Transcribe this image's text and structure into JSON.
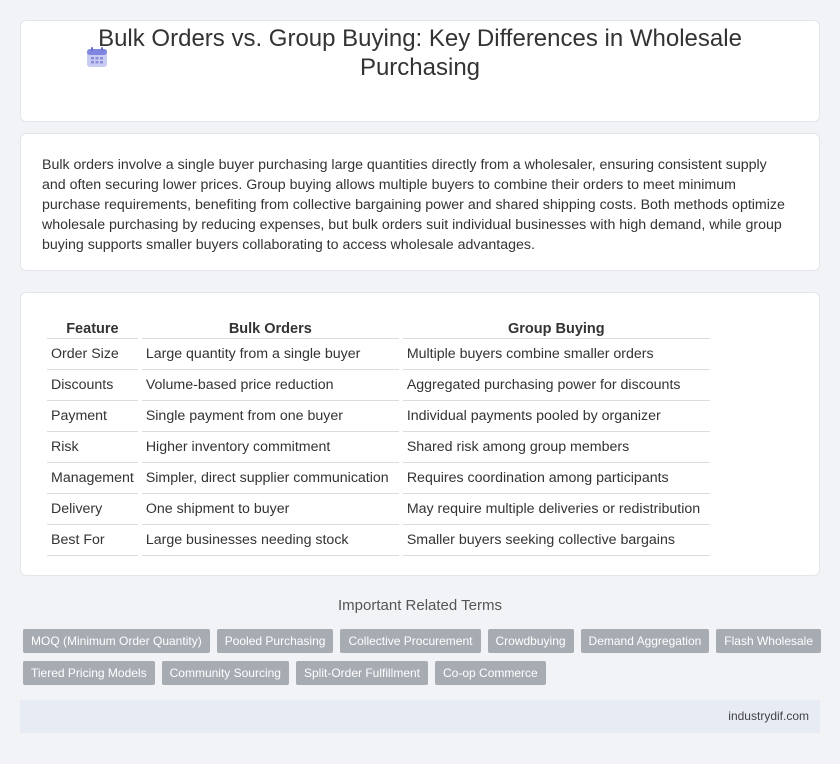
{
  "header": {
    "title": "Bulk Orders vs. Group Buying: Key Differences in Wholesale Purchasing",
    "icon": "calendar-icon"
  },
  "intro": {
    "text": "Bulk orders involve a single buyer purchasing large quantities directly from a wholesaler, ensuring consistent supply and often securing lower prices. Group buying allows multiple buyers to combine their orders to meet minimum purchase requirements, benefiting from collective bargaining power and shared shipping costs. Both methods optimize wholesale purchasing by reducing expenses, but bulk orders suit individual businesses with high demand, while group buying supports smaller buyers collaborating to access wholesale advantages."
  },
  "table": {
    "headers": [
      "Feature",
      "Bulk Orders",
      "Group Buying"
    ],
    "rows": [
      [
        "Order Size",
        "Large quantity from a single buyer",
        "Multiple buyers combine smaller orders"
      ],
      [
        "Discounts",
        "Volume-based price reduction",
        "Aggregated purchasing power for discounts"
      ],
      [
        "Payment",
        "Single payment from one buyer",
        "Individual payments pooled by organizer"
      ],
      [
        "Risk",
        "Higher inventory commitment",
        "Shared risk among group members"
      ],
      [
        "Management",
        "Simpler, direct supplier communication",
        "Requires coordination among participants"
      ],
      [
        "Delivery",
        "One shipment to buyer",
        "May require multiple deliveries or redistribution"
      ],
      [
        "Best For",
        "Large businesses needing stock",
        "Smaller buyers seeking collective bargains"
      ]
    ]
  },
  "related": {
    "title": "Important Related Terms",
    "tags_row1": [
      "MOQ (Minimum Order Quantity)",
      "Pooled Purchasing",
      "Collective Procurement",
      "Crowdbuying",
      "Demand Aggregation",
      "Flash Wholesale"
    ],
    "tags_row2": [
      "Tiered Pricing Models",
      "Community Sourcing",
      "Split-Order Fulfillment",
      "Co-op Commerce"
    ]
  },
  "footer": {
    "site": "industrydif.com"
  },
  "colors": {
    "background": "#f1f3f7",
    "tag": "#a7acb3",
    "footer": "#e6ebf4",
    "icon": "#8a8fd8"
  }
}
